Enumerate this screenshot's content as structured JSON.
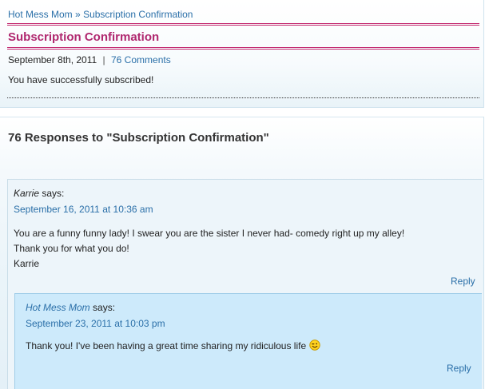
{
  "breadcrumb": {
    "home": "Hot Mess Mom",
    "separator": "»",
    "current": "Subscription Confirmation"
  },
  "post": {
    "title": "Subscription Confirmation",
    "date": "September 8th, 2011",
    "divider": "|",
    "comments_link": "76 Comments",
    "body": "You have successfully subscribed!"
  },
  "responses": {
    "heading": "76 Responses to \"Subscription Confirmation\"",
    "comments": [
      {
        "author": "Karrie",
        "says": "says:",
        "date": "September 16, 2011 at 10:36 am",
        "lines": [
          "You are a funny funny lady! I swear you are the sister I never had- comedy right up my alley!",
          "Thank you for what you do!",
          "Karrie"
        ],
        "reply_label": "Reply",
        "replies": [
          {
            "author": "Hot Mess Mom",
            "says": "says:",
            "date": "September 23, 2011 at 10:03 pm",
            "text": "Thank you! I've been having a great time sharing my ridiculous life",
            "emoticon": "smiley-wink-icon",
            "reply_label": "Reply"
          }
        ]
      }
    ]
  },
  "colors": {
    "link": "#2a6fa8",
    "title": "#b0286f",
    "title_rule": "#c2276e",
    "reply_bg": "#cdeafb"
  }
}
